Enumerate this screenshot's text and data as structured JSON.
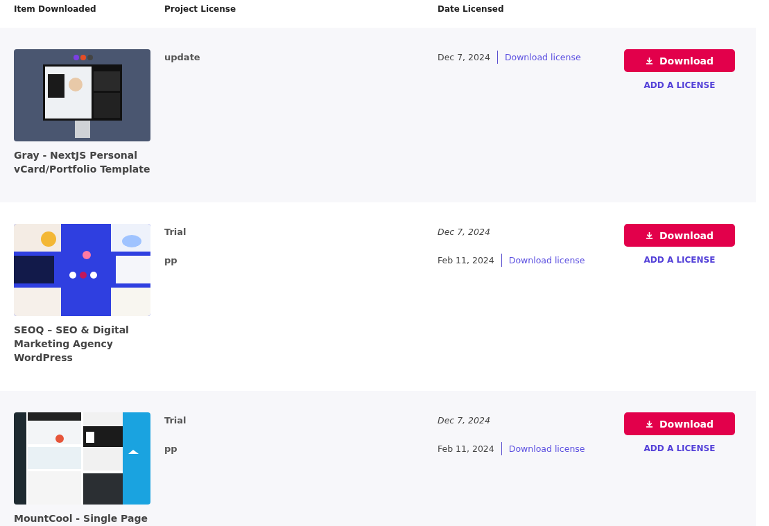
{
  "columns": [
    "Item Downloaded",
    "Project License",
    "Date Licensed"
  ],
  "rows": [
    {
      "title": "Gray - NextJS Personal vCard/Portfolio Template",
      "licenses": [
        {
          "project": "update",
          "date": "Dec 7, 2024",
          "link": "Download license"
        }
      ],
      "download_button": "Download",
      "add_license": "ADD A LICENSE"
    },
    {
      "title": "SEOQ – SEO & Digital Marketing Agency WordPress",
      "licenses": [
        {
          "project": "Trial",
          "date": "Dec 7, 2024"
        },
        {
          "project": "pp",
          "date": "Feb 11, 2024",
          "link": "Download license"
        }
      ],
      "download_button": "Download",
      "add_license": "ADD A LICENSE"
    },
    {
      "title": "MountCool - Single Page",
      "licenses": [
        {
          "project": "Trial",
          "date": "Dec 7, 2024"
        },
        {
          "project": "pp",
          "date": "Feb 11, 2024",
          "link": "Download license"
        }
      ],
      "download_button": "Download",
      "add_license": "ADD A LICENSE"
    }
  ]
}
